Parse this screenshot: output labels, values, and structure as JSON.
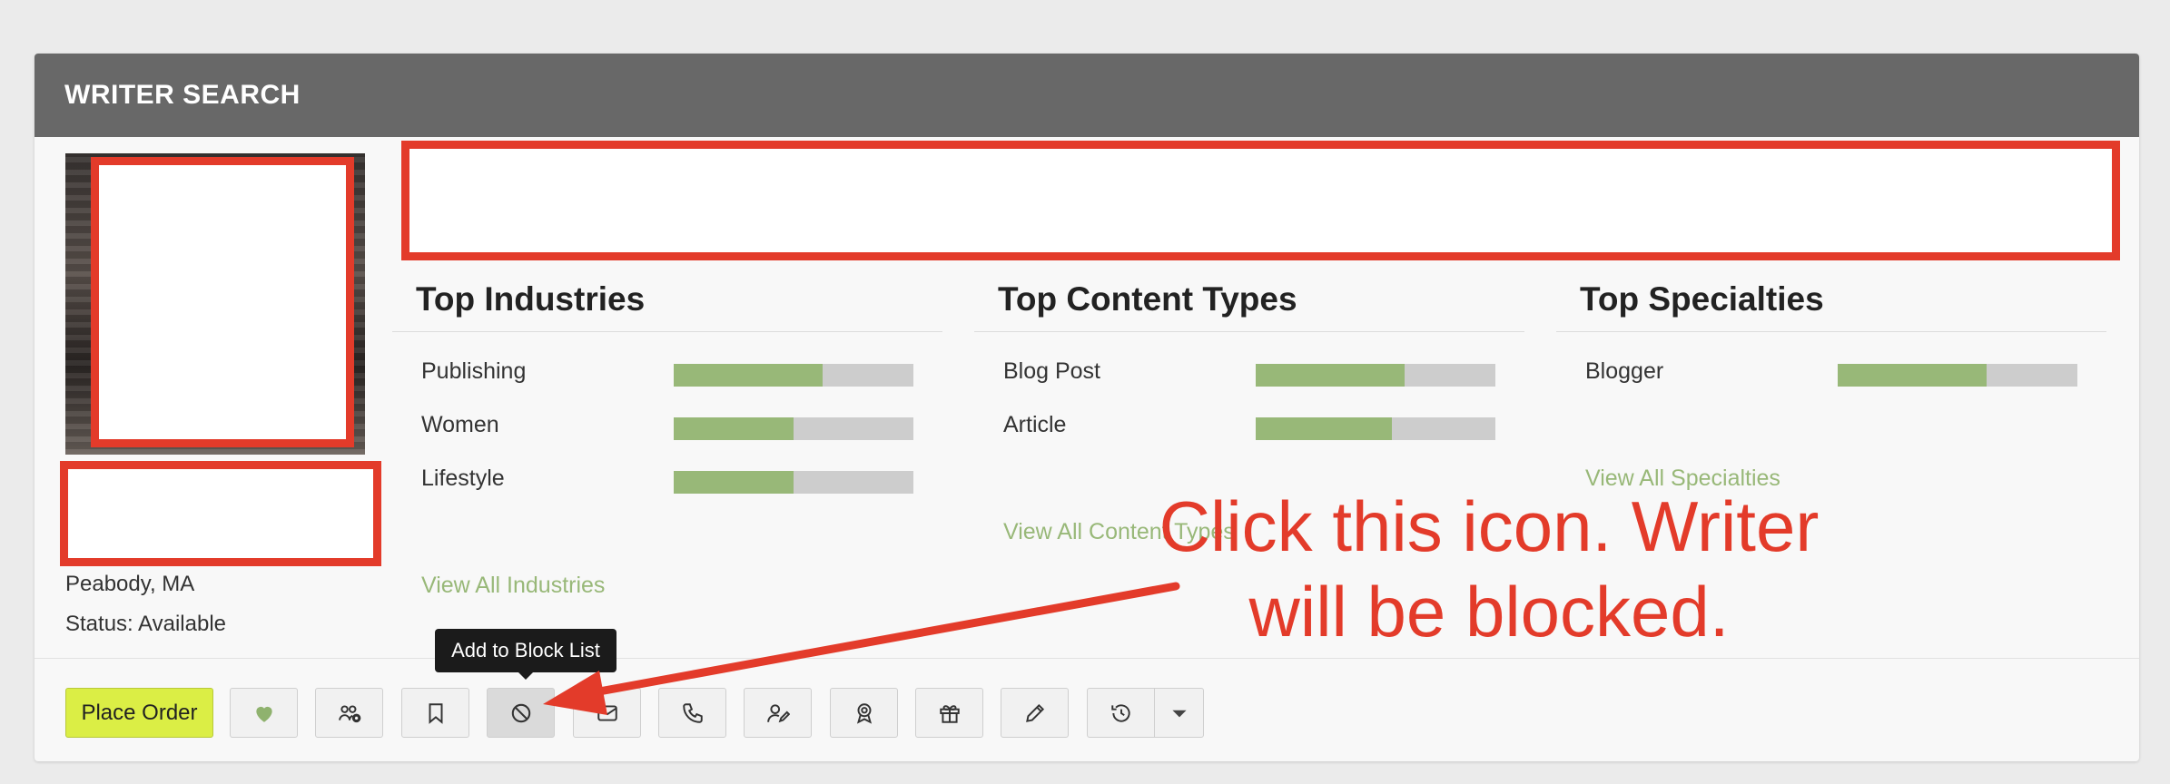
{
  "panel": {
    "title": "WRITER SEARCH"
  },
  "profile": {
    "location": "Peabody, MA",
    "status": "Status: Available"
  },
  "columns": [
    {
      "title": "Top Industries",
      "items": [
        {
          "label": "Publishing",
          "level": 0.62
        },
        {
          "label": "Women",
          "level": 0.5
        },
        {
          "label": "Lifestyle",
          "level": 0.5
        }
      ],
      "view_all": "View All Industries"
    },
    {
      "title": "Top Content Types",
      "items": [
        {
          "label": "Blog Post",
          "level": 0.62
        },
        {
          "label": "Article",
          "level": 0.57
        }
      ],
      "view_all": "View All Content Types"
    },
    {
      "title": "Top Specialties",
      "items": [
        {
          "label": "Blogger",
          "level": 0.62
        }
      ],
      "view_all": "View All Specialties"
    }
  ],
  "toolbar": {
    "place_order": "Place Order",
    "tooltip": "Add to Block List",
    "icons": [
      "heart-icon",
      "user-plus-icon",
      "bookmark-icon",
      "block-icon",
      "mail-icon",
      "phone-icon",
      "user-edit-icon",
      "award-icon",
      "gift-icon",
      "pencil-icon",
      "history-icon",
      "caret-down-icon"
    ]
  },
  "annotation": {
    "line1": "Click this icon. Writer",
    "line2": "will be blocked."
  },
  "colors": {
    "header_bg": "#686868",
    "accent_green": "#98b878",
    "place_order_bg": "#dbee45",
    "annotation_red": "#e33b2a"
  }
}
